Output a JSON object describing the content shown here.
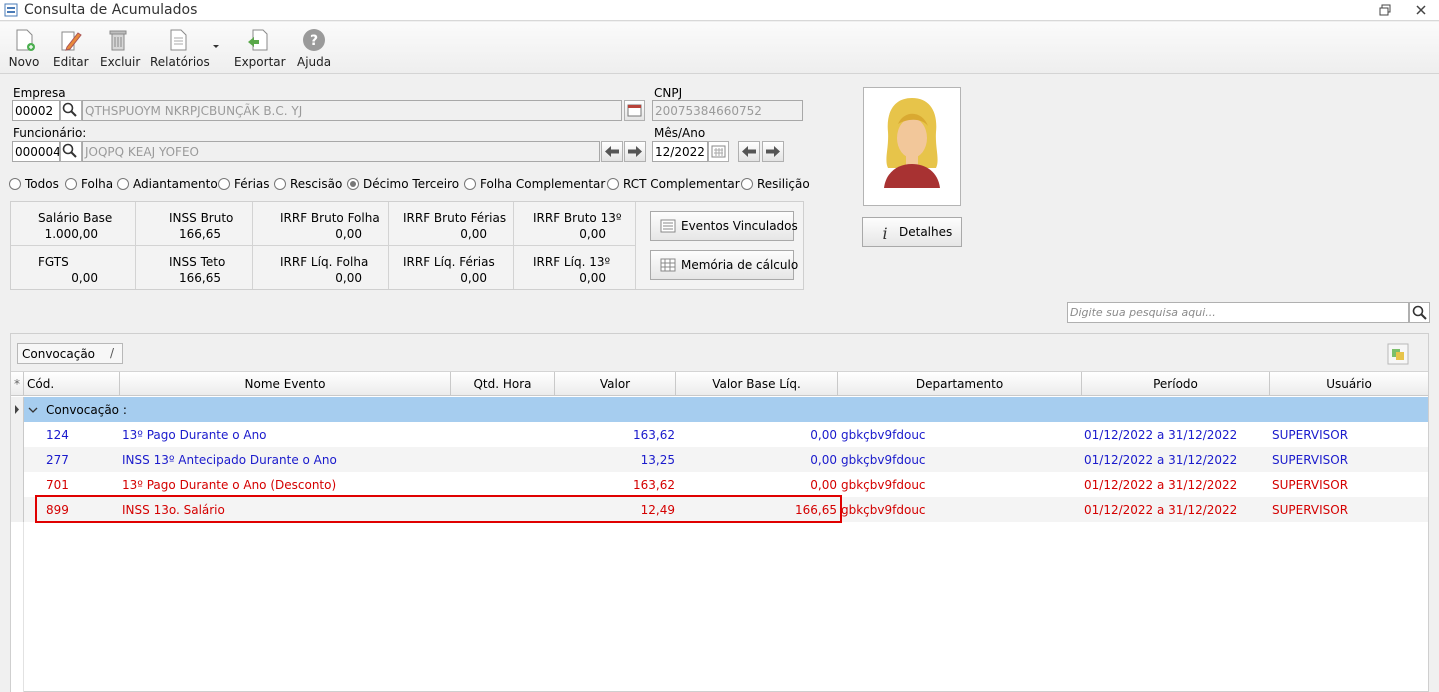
{
  "window": {
    "title": "Consulta de Acumulados"
  },
  "toolbar": {
    "novo": "Novo",
    "editar": "Editar",
    "excluir": "Excluir",
    "relatorios": "Relatórios",
    "exportar": "Exportar",
    "ajuda": "Ajuda"
  },
  "form": {
    "empresa_label": "Empresa",
    "empresa_code": "00002",
    "empresa_name": "QTHSPUOYM NKRPJCBUNÇÃK B.C. YJ",
    "cnpj_label": "CNPJ",
    "cnpj_value": "20075384660752",
    "funcionario_label": "Funcionário:",
    "funcionario_code": "000004",
    "funcionario_name": "JOQPQ KEAJ YOFEO",
    "mesano_label": "Mês/Ano",
    "mesano_value": "12/2022"
  },
  "filters": [
    {
      "label": "Todos",
      "selected": false
    },
    {
      "label": "Folha",
      "selected": false
    },
    {
      "label": "Adiantamento",
      "selected": false
    },
    {
      "label": "Férias",
      "selected": false
    },
    {
      "label": "Rescisão",
      "selected": false
    },
    {
      "label": "Décimo Terceiro",
      "selected": true
    },
    {
      "label": "Folha Complementar",
      "selected": false
    },
    {
      "label": "RCT Complementar",
      "selected": false
    },
    {
      "label": "Resilição",
      "selected": false
    }
  ],
  "totals": [
    {
      "label": "Salário Base",
      "value": "1.000,00"
    },
    {
      "label": "INSS Bruto",
      "value": "166,65"
    },
    {
      "label": "IRRF Bruto Folha",
      "value": "0,00"
    },
    {
      "label": "IRRF Bruto Férias",
      "value": "0,00"
    },
    {
      "label": "IRRF Bruto 13º",
      "value": "0,00"
    },
    {
      "label": "FGTS",
      "value": "0,00"
    },
    {
      "label": "INSS Teto",
      "value": "166,65"
    },
    {
      "label": "IRRF Líq. Folha",
      "value": "0,00"
    },
    {
      "label": "IRRF Líq. Férias",
      "value": "0,00"
    },
    {
      "label": "IRRF Líq. 13º",
      "value": "0,00"
    }
  ],
  "buttons": {
    "eventos": "Eventos Vinculados",
    "memoria": "Memória de cálculo",
    "detalhes": "Detalhes"
  },
  "search": {
    "placeholder": "Digite sua pesquisa aqui..."
  },
  "grid": {
    "group_tag": "Convocação",
    "columns": [
      "Cód.",
      "Nome Evento",
      "Qtd. Hora",
      "Valor",
      "Valor Base Líq.",
      "Departamento",
      "Período",
      "Usuário"
    ],
    "group_label": "Convocação :",
    "rows": [
      {
        "cod": "124",
        "nome": "13º Pago Durante o Ano",
        "qtd": "",
        "valor": "163,62",
        "base": "0,00",
        "depto": "gbkçbv9fdouc",
        "periodo": "01/12/2022 a 31/12/2022",
        "usuario": "SUPERVISOR",
        "color": "#1a1acc"
      },
      {
        "cod": "277",
        "nome": "INSS 13º Antecipado Durante o Ano",
        "qtd": "",
        "valor": "13,25",
        "base": "0,00",
        "depto": "gbkçbv9fdouc",
        "periodo": "01/12/2022 a 31/12/2022",
        "usuario": "SUPERVISOR",
        "color": "#1a1acc"
      },
      {
        "cod": "701",
        "nome": "13º Pago Durante o Ano (Desconto)",
        "qtd": "",
        "valor": "163,62",
        "base": "0,00",
        "depto": "gbkçbv9fdouc",
        "periodo": "01/12/2022 a 31/12/2022",
        "usuario": "SUPERVISOR",
        "color": "#d40000"
      },
      {
        "cod": "899",
        "nome": "INSS 13o. Salário",
        "qtd": "",
        "valor": "12,49",
        "base": "166,65",
        "depto": "gbkçbv9fdouc",
        "periodo": "01/12/2022 a 31/12/2022",
        "usuario": "SUPERVISOR",
        "color": "#d40000"
      }
    ]
  },
  "colors": {
    "group_row_bg": "#a6cdef",
    "highlight_border": "#e00000"
  }
}
